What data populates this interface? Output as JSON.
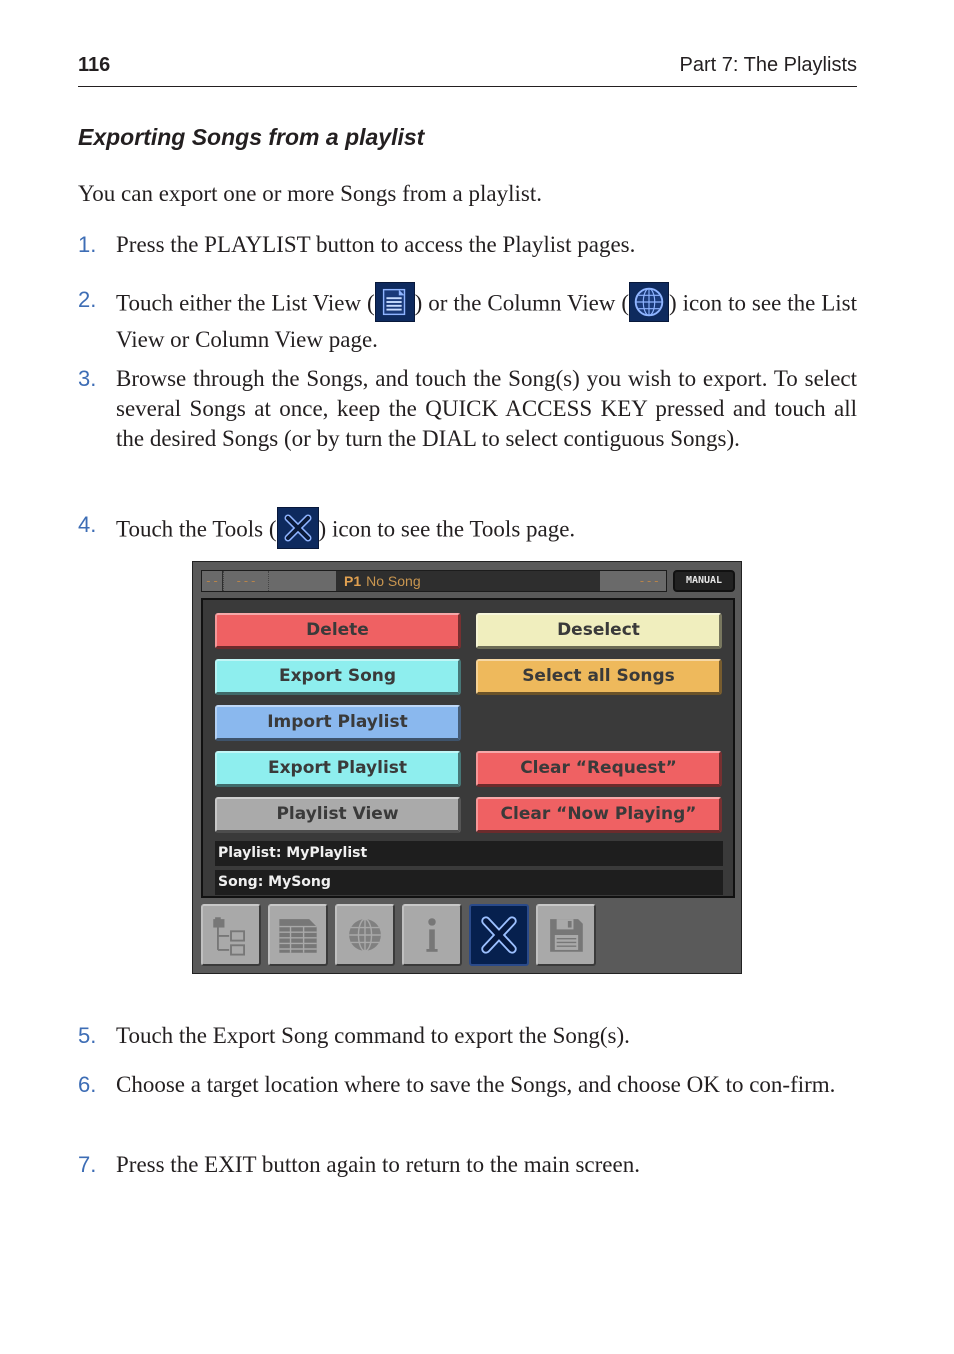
{
  "header": {
    "page_number": "116",
    "part_title": "Part 7: The Playlists"
  },
  "section": {
    "title": "Exporting Songs from a playlist",
    "intro": "You can export one or more Songs from a playlist."
  },
  "steps": [
    {
      "num": "1.",
      "text": "Press the PLAYLIST button to access the Playlist pages."
    },
    {
      "num": "2.",
      "before": "Touch either the List View (",
      "icon1": "list-view-icon",
      "middle": ") or the Column View (",
      "icon2": "column-view-icon",
      "after": ") icon to see the List View or Column View page."
    },
    {
      "num": "3.",
      "text": "Browse through the Songs, and touch the Song(s) you wish to export. To select several Songs at once, keep the QUICK ACCESS KEY pressed and touch all the desired Songs (or by turn the DIAL to select contiguous Songs)."
    },
    {
      "num": "4.",
      "before": "Touch the Tools (",
      "icon1": "tools-icon",
      "after": ") icon to see the Tools page."
    },
    {
      "num": "5.",
      "text": "Touch the Export Song command to export the Song(s)."
    },
    {
      "num": "6.",
      "text": "Choose a target location where to save the Songs, and choose OK to con-firm."
    },
    {
      "num": "7.",
      "text": "Press the EXIT button again to return to the main screen."
    }
  ],
  "screen": {
    "topbar": {
      "seg1": "--",
      "seg2": "---",
      "program": "P1",
      "song": "No Song",
      "seg4": "---",
      "mode": "MANUAL"
    },
    "buttons": [
      {
        "label": "Delete",
        "color": "#ef6163"
      },
      {
        "label": "Deselect",
        "color": "#f0eebe"
      },
      {
        "label": "Export Song",
        "color": "#8eeeee"
      },
      {
        "label": "Select all Songs",
        "color": "#eeb95c"
      },
      {
        "label": "Import Playlist",
        "color": "#8ab8ee"
      },
      {
        "label": "Export Playlist",
        "color": "#8eeeee"
      },
      {
        "label": "Clear “Request”",
        "color": "#ef6163"
      },
      {
        "label": "Playlist View",
        "color": "#aaaaaa"
      },
      {
        "label": "Clear “Now Playing”",
        "color": "#ef6163"
      }
    ],
    "info": {
      "playlist": "Playlist: MyPlaylist",
      "song": "Song: MySong"
    },
    "tabs": [
      {
        "icon": "tree-view-icon",
        "active": false
      },
      {
        "icon": "list-view-icon",
        "active": false
      },
      {
        "icon": "column-view-icon",
        "active": false
      },
      {
        "icon": "info-icon",
        "active": false
      },
      {
        "icon": "tools-icon",
        "active": true
      },
      {
        "icon": "save-icon",
        "active": false
      }
    ]
  }
}
